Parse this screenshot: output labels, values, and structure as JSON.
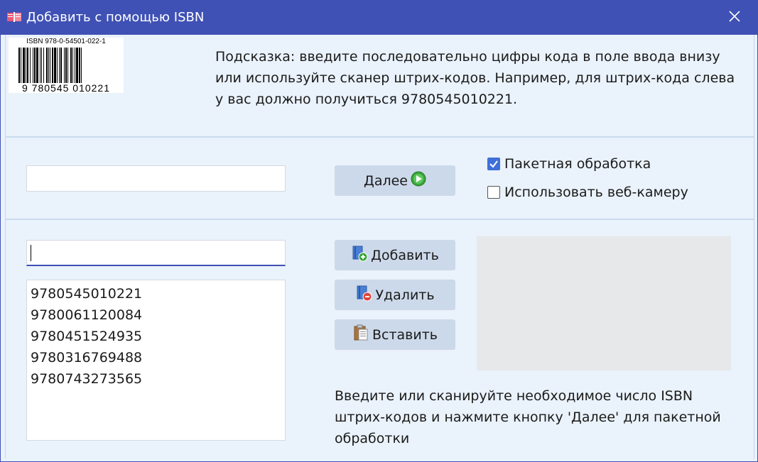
{
  "window": {
    "title": "Добавить с помощью ISBN",
    "accent_color": "#3f51b5",
    "close_icon": "close-icon",
    "app_icon": "books-icon"
  },
  "barcode": {
    "top_text": "ISBN 978-0-54501-022-1",
    "digits": "9 780545 010221"
  },
  "hint": {
    "text": "Подсказка: введите последовательно цифры кода в поле ввода внизу или используйте сканер штрих-кодов. Например, для штрих-кода слева у вас должно получиться 9780545010221."
  },
  "top_section": {
    "isbn_input_value": "",
    "next_button_label": "Далее",
    "next_icon": "play-circle-icon",
    "batch_checkbox": {
      "label": "Пакетная обработка",
      "checked": true
    },
    "webcam_checkbox": {
      "label": "Использовать веб-камеру",
      "checked": false
    }
  },
  "batch_section": {
    "batch_input_value": "",
    "isbn_list": [
      "9780545010221",
      "9780061120084",
      "9780451524935",
      "9780316769488",
      "9780743273565"
    ],
    "add_button_label": "Добавить",
    "add_icon": "book-add-icon",
    "delete_button_label": "Удалить",
    "delete_icon": "book-remove-icon",
    "paste_button_label": "Вставить",
    "paste_icon": "clipboard-icon",
    "info_text": "Введите или сканируйте необходимое число ISBN штрих-кодов и нажмите кнопку 'Далее' для пакетной обработки"
  }
}
